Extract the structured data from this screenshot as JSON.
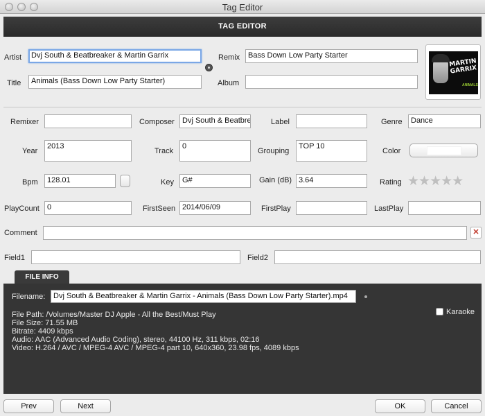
{
  "window": {
    "title": "Tag Editor"
  },
  "header": {
    "title": "TAG EDITOR"
  },
  "tags": {
    "artist": {
      "label": "Artist",
      "value": "Dvj South & Beatbreaker & Martin Garrix"
    },
    "remix": {
      "label": "Remix",
      "value": "Bass Down Low Party Starter"
    },
    "title": {
      "label": "Title",
      "value": "Animals (Bass Down Low Party Starter)"
    },
    "album": {
      "label": "Album",
      "value": ""
    },
    "remixer": {
      "label": "Remixer",
      "value": ""
    },
    "composer": {
      "label": "Composer",
      "value": "Dvj South & Beatbrea"
    },
    "label_field": {
      "label": "Label",
      "value": ""
    },
    "genre": {
      "label": "Genre",
      "value": "Dance"
    },
    "year": {
      "label": "Year",
      "value": "2013"
    },
    "track": {
      "label": "Track",
      "value": "0"
    },
    "grouping": {
      "label": "Grouping",
      "value": "TOP 10"
    },
    "color": {
      "label": "Color",
      "value_hex": "#ffffff"
    },
    "bpm": {
      "label": "Bpm",
      "value": "128.01"
    },
    "key": {
      "label": "Key",
      "value": "G#"
    },
    "gain": {
      "label": "Gain (dB)",
      "value": "3.64"
    },
    "rating": {
      "label": "Rating",
      "stars_glyph": "★★★★★",
      "value": 0,
      "max": 5
    },
    "playcount": {
      "label": "PlayCount",
      "value": "0"
    },
    "firstseen": {
      "label": "FirstSeen",
      "value": "2014/06/09"
    },
    "firstplay": {
      "label": "FirstPlay",
      "value": ""
    },
    "lastplay": {
      "label": "LastPlay",
      "value": ""
    },
    "comment": {
      "label": "Comment",
      "value": ""
    },
    "field1": {
      "label": "Field1",
      "value": ""
    },
    "field2": {
      "label": "Field2",
      "value": ""
    }
  },
  "artwork": {
    "logo_text": "MARTIN GARRIX",
    "sub_text": "ANIMALS"
  },
  "file_info": {
    "tab_label": "FILE INFO",
    "filename_label": "Filename:",
    "filename": "Dvj South & Beatbreaker & Martin Garrix - Animals (Bass Down Low Party Starter).mp4",
    "karaoke_label": "Karaoke",
    "lines": [
      "File Path: /Volumes/Master DJ Apple - All the Best/Must Play",
      "File Size: 71.55 MB",
      "Bitrate: 4409 kbps",
      "Audio: AAC (Advanced Audio Coding), stereo, 44100 Hz, 311 kbps, 02:16",
      "Video: H.264 / AVC / MPEG-4 AVC / MPEG-4 part 10, 640x360, 23.98 fps, 4089 kbps"
    ]
  },
  "buttons": {
    "prev": "Prev",
    "next": "Next",
    "ok": "OK",
    "cancel": "Cancel",
    "clear_glyph": "✕"
  },
  "colors": {
    "header_bg": "#2f2f2f",
    "info_bg": "#353535",
    "focus": "#7aa7e6"
  }
}
